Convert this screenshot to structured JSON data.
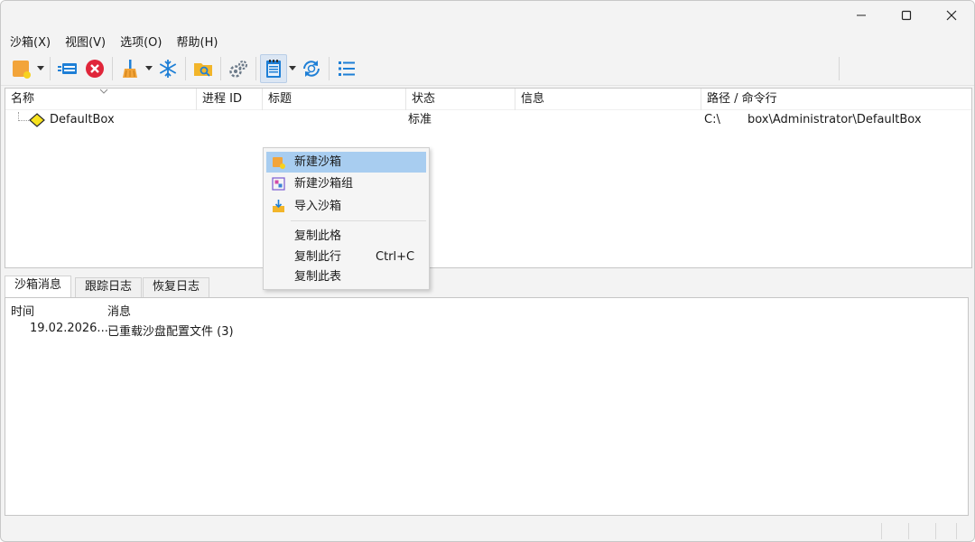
{
  "window": {
    "controls": {
      "minimize": "minimize",
      "maximize": "maximize",
      "close": "close"
    }
  },
  "menu": [
    "沙箱(X)",
    "视图(V)",
    "选项(O)",
    "帮助(H)"
  ],
  "toolbar": {
    "icons": [
      "new-box-icon",
      "dropdown-arrow-icon",
      "programs-icon",
      "terminate-all-icon",
      "cleanup-icon",
      "dropdown-arrow-icon",
      "freeze-icon",
      "browse-files-icon",
      "settings-gears-icon",
      "notepad-icon",
      "dropdown-arrow-icon",
      "refresh-icon",
      "list-view-icon"
    ]
  },
  "tree": {
    "columns": [
      "名称",
      "进程 ID",
      "标题",
      "状态",
      "信息",
      "路径 / 命令行"
    ],
    "rows": [
      {
        "name": "DefaultBox",
        "pid": "",
        "title": "",
        "status": "标准",
        "info": "",
        "path_prefix": "C:\\",
        "path_rest": "box\\Administrator\\DefaultBox"
      }
    ]
  },
  "context_menu": {
    "items": [
      {
        "label": "新建沙箱",
        "shortcut": "",
        "icon": "new-box-icon",
        "highlighted": true
      },
      {
        "label": "新建沙箱组",
        "shortcut": "",
        "icon": "new-group-icon",
        "highlighted": false
      },
      {
        "label": "导入沙箱",
        "shortcut": "",
        "icon": "import-box-icon",
        "highlighted": false
      },
      {
        "label": "复制此格",
        "shortcut": "",
        "icon": "",
        "highlighted": false
      },
      {
        "label": "复制此行",
        "shortcut": "Ctrl+C",
        "icon": "",
        "highlighted": false
      },
      {
        "label": "复制此表",
        "shortcut": "",
        "icon": "",
        "highlighted": false
      }
    ]
  },
  "tabs": [
    {
      "label": "沙箱消息",
      "active": true
    },
    {
      "label": "跟踪日志",
      "active": false
    },
    {
      "label": "恢复日志",
      "active": false
    }
  ],
  "log": {
    "columns": [
      "时间",
      "消息"
    ],
    "rows": [
      {
        "time": "19.02.2026...",
        "message": "已重载沙盘配置文件 (3)"
      }
    ]
  },
  "colors": {
    "highlight": "#a8cdf0",
    "window_bg": "#f3f3f3",
    "accent_blue": "#1e7fd6",
    "orange": "#f2a43a",
    "red": "#e0263a"
  }
}
